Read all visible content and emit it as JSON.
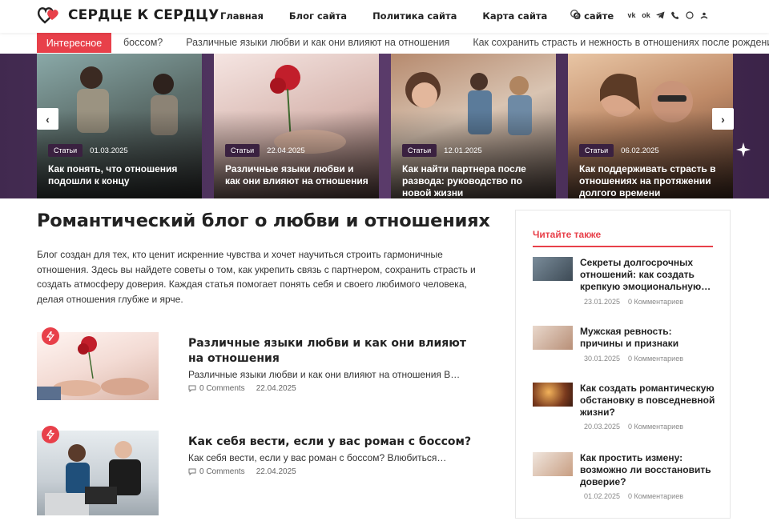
{
  "logo": {
    "text": "СЕРДЦЕ К СЕРДЦУ"
  },
  "nav": {
    "items": [
      "Главная",
      "Блог сайта",
      "Политика сайта",
      "Карта сайта",
      "О сайте"
    ]
  },
  "icons": {
    "search": "search-icon",
    "socials": [
      "vk-icon",
      "ok-icon",
      "telegram-icon",
      "phone-icon",
      "whatsapp-icon",
      "more-icon"
    ]
  },
  "ticker": {
    "badge": "Интересное",
    "items": [
      "боссом?",
      "Различные языки любви и как они влияют на отношения",
      "Как сохранить страсть и нежность в отношениях после рождения"
    ]
  },
  "slider": {
    "slides": [
      {
        "category": "Статьи",
        "date": "01.03.2025",
        "title": "Как понять, что отношения подошли к концу"
      },
      {
        "category": "Статьи",
        "date": "22.04.2025",
        "title": "Различные языки любви и как они влияют на отношения"
      },
      {
        "category": "Статьи",
        "date": "12.01.2025",
        "title": "Как найти партнера после развода: руководство по новой жизни"
      },
      {
        "category": "Статьи",
        "date": "06.02.2025",
        "title": "Как поддерживать страсть в отношениях на протяжении долгого времени"
      }
    ],
    "prev_label": "‹",
    "next_label": "›"
  },
  "main": {
    "title": "Романтический блог о любви и отношениях",
    "intro": "Блог создан для тех, кто ценит искренние чувства и хочет научиться строить гармоничные отношения. Здесь вы найдете советы о том, как укрепить связь с партнером, сохранить страсть и создать атмосферу доверия. Каждая статья помогает понять себя и своего любимого человека, делая отношения глубже и ярче.",
    "posts": [
      {
        "title": "Различные языки любви и как они влияют на отношения",
        "excerpt": "Различные языки любви и как они влияют на отношения В…",
        "comments": "0 Comments",
        "date": "22.04.2025"
      },
      {
        "title": "Как себя вести, если у вас роман с боссом?",
        "excerpt": "Как себя вести, если у вас роман с боссом? Влюбиться…",
        "comments": "0 Comments",
        "date": "22.04.2025"
      }
    ]
  },
  "sidebar": {
    "heading": "Читайте также",
    "items": [
      {
        "title": "Секреты долгосрочных отношений: как создать крепкую эмоциональную…",
        "date": "23.01.2025",
        "comments": "0 Комментариев"
      },
      {
        "title": "Мужская ревность: причины и признаки",
        "date": "30.01.2025",
        "comments": "0 Комментариев"
      },
      {
        "title": "Как создать романтическую обстановку в повседневной жизни?",
        "date": "20.03.2025",
        "comments": "0 Комментариев"
      },
      {
        "title": "Как простить измену: возможно ли восстановить доверие?",
        "date": "01.02.2025",
        "comments": "0 Комментариев"
      }
    ]
  },
  "colors": {
    "accent": "#e8404a",
    "slider_bg": "#4a2d5a",
    "text": "#222222"
  }
}
